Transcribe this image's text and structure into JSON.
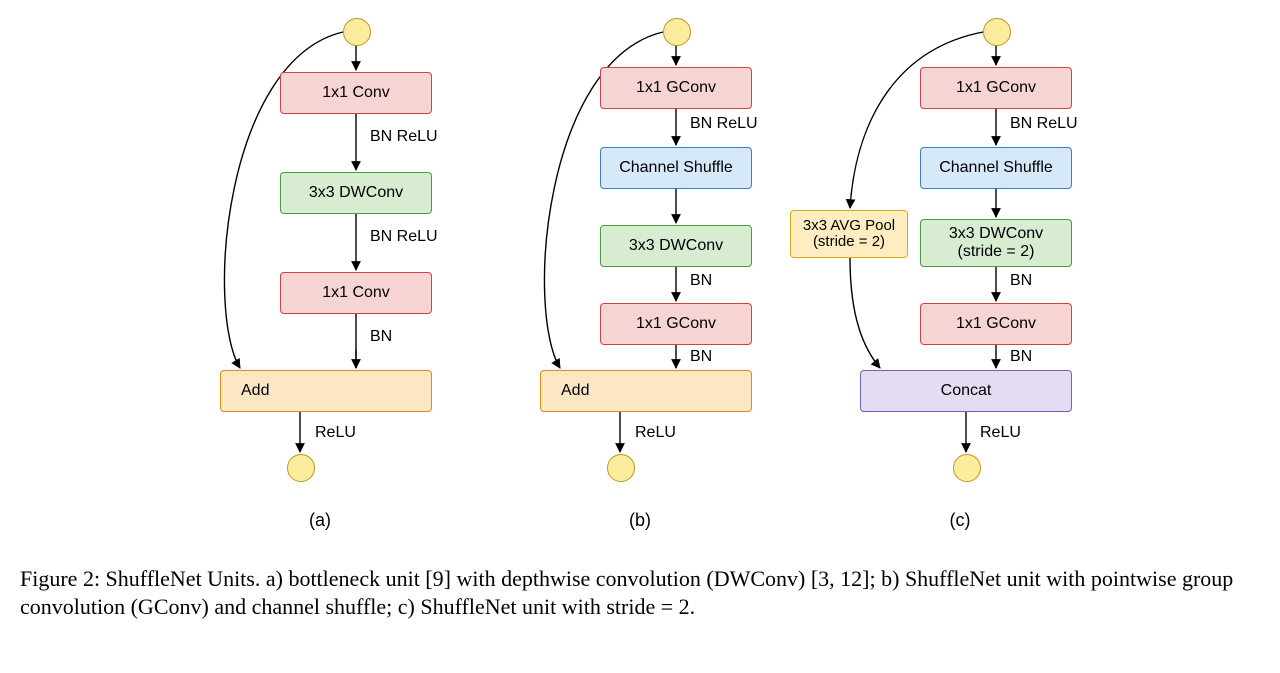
{
  "caption_prefix": "Figure 2: ShuffleNet Units. a) bottleneck unit [9] with depthwise convolution (DWConv) [3, 12]; b) ShuffleNet unit with pointwise group convolution (GConv) and channel shuffle; c) ShuffleNet unit with stride = 2.",
  "unit_a": {
    "sublabel": "(a)",
    "box1": "1x1 Conv",
    "box2": "3x3 DWConv",
    "box3": "1x1 Conv",
    "combine": "Add",
    "ann1": "BN ReLU",
    "ann2": "BN ReLU",
    "ann3": "BN",
    "ann4": "ReLU"
  },
  "unit_b": {
    "sublabel": "(b)",
    "box1": "1x1 GConv",
    "shuffle": "Channel Shuffle",
    "box2": "3x3 DWConv",
    "box3": "1x1 GConv",
    "combine": "Add",
    "ann1": "BN ReLU",
    "ann2": "BN",
    "ann3": "BN",
    "ann4": "ReLU"
  },
  "unit_c": {
    "sublabel": "(c)",
    "box1": "1x1 GConv",
    "shuffle": "Channel Shuffle",
    "box2_l1": "3x3 DWConv",
    "box2_l2": "(stride = 2)",
    "box3": "1x1 GConv",
    "pool_l1": "3x3 AVG Pool",
    "pool_l2": "(stride = 2)",
    "combine": "Concat",
    "ann1": "BN ReLU",
    "ann2": "BN",
    "ann3": "BN",
    "ann4": "ReLU"
  }
}
